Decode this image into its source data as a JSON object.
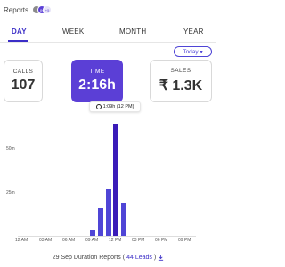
{
  "header": {
    "title": "Reports",
    "avatar_badge_1": "IN",
    "avatar_badge_2": "+5"
  },
  "tabs": [
    {
      "label": "DAY"
    },
    {
      "label": "WEEK"
    },
    {
      "label": "MONTH"
    },
    {
      "label": "YEAR"
    }
  ],
  "period_select": {
    "label": "Today"
  },
  "stats": {
    "calls": {
      "label": "CALLS",
      "value": "107"
    },
    "time": {
      "label": "TIME",
      "value": "2:16h"
    },
    "sales": {
      "label": "SALES",
      "value": "₹ 1.3K"
    }
  },
  "tooltip": {
    "text": "1:09h (12 PM)"
  },
  "chart_data": {
    "type": "bar",
    "categories": [
      "12 AM",
      "1 AM",
      "2 AM",
      "3 AM",
      "4 AM",
      "5 AM",
      "6 AM",
      "7 AM",
      "8 AM",
      "9 AM",
      "10 AM",
      "11 AM",
      "12 PM",
      "1 PM",
      "2 PM",
      "3 PM",
      "4 PM",
      "5 PM",
      "6 PM",
      "7 PM",
      "8 PM",
      "9 PM",
      "10 PM",
      "11 PM"
    ],
    "x_tick_labels": [
      "12 AM",
      "03 AM",
      "06 AM",
      "09 AM",
      "12 PM",
      "03 PM",
      "06 PM",
      "09 PM"
    ],
    "y_tick_labels": [
      "25m",
      "50m"
    ],
    "values_minutes": [
      0,
      0,
      0,
      0,
      0,
      0,
      0,
      0,
      0,
      4,
      17,
      29,
      69,
      20,
      0,
      0,
      0,
      0,
      0,
      0,
      0,
      0,
      0,
      0
    ],
    "highlight_index": 12,
    "ylim": [
      0,
      70
    ],
    "accent_color": "#4f45d6",
    "highlight_color": "#3a1bb8"
  },
  "footer": {
    "prefix": "29 Sep Duration Reports",
    "leads": "44 Leads"
  }
}
